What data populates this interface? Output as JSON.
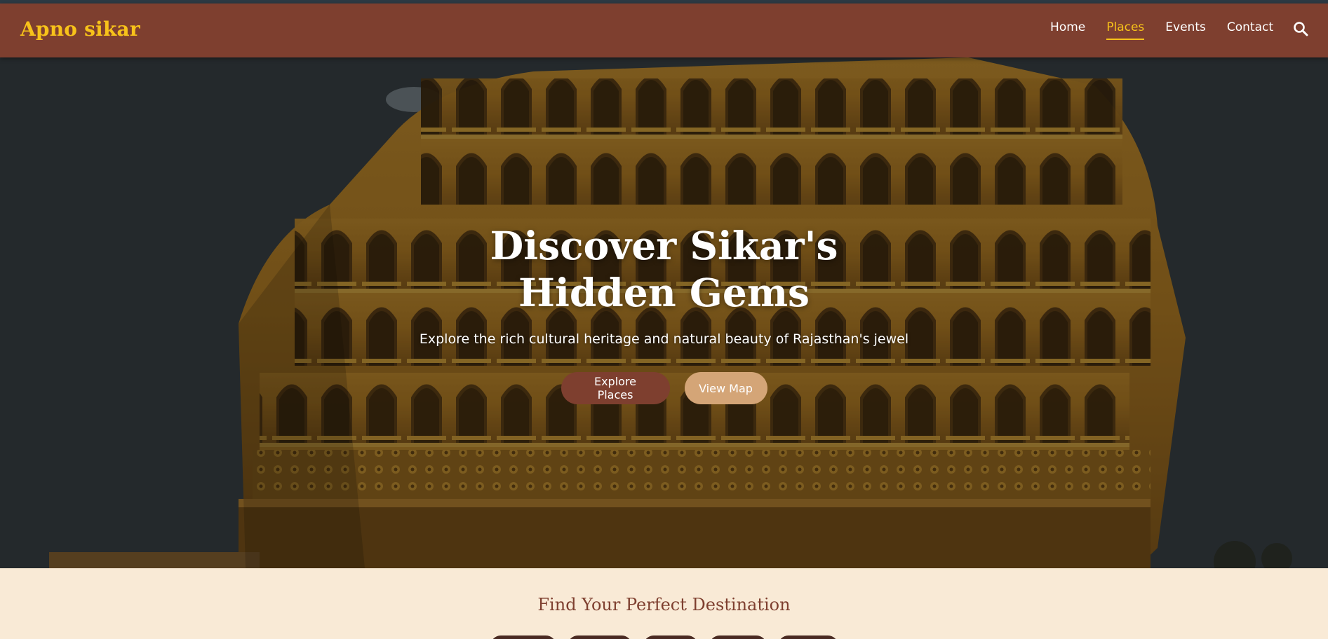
{
  "brand": {
    "logo_text": "Apno sikar"
  },
  "nav": {
    "items": [
      {
        "label": "Home",
        "active": false
      },
      {
        "label": "Places",
        "active": true
      },
      {
        "label": "Events",
        "active": false
      },
      {
        "label": "Contact",
        "active": false
      }
    ],
    "search_icon": "search-icon"
  },
  "hero": {
    "title": "Discover Sikar's Hidden Gems",
    "subtitle": "Explore the rich cultural heritage and natural beauty of Rajasthan's jewel",
    "primary_button": "Explore Places",
    "secondary_button": "View Map"
  },
  "finder": {
    "title": "Find Your Perfect Destination"
  },
  "colors": {
    "navbar": "#7e3f2f",
    "accent_yellow": "#f7c21a",
    "primary_button": "#7e3f2f",
    "secondary_button": "#d4a577",
    "section_background": "#f9ead6"
  }
}
